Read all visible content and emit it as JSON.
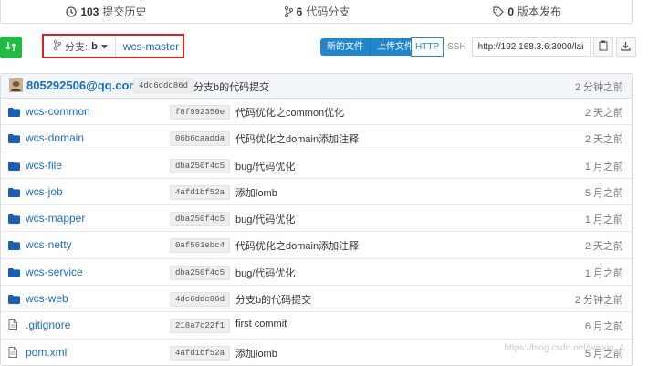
{
  "stats": {
    "commits": {
      "count": "103",
      "label": "提交历史"
    },
    "branches": {
      "count": "6",
      "label": "代码分支"
    },
    "releases": {
      "count": "0",
      "label": "版本发布"
    }
  },
  "toolbar": {
    "branch_prefix": "分支:",
    "branch_name": "b",
    "tree_path": "wcs-master",
    "new_file": "新的文件",
    "upload_file": "上传文件",
    "protocol_http": "HTTP",
    "protocol_ssh": "SSH",
    "clone_url": "http://192.168.3.6:3000/lai"
  },
  "latest_commit": {
    "author": "805292506@qq.com",
    "sha": "4dc6ddc86d",
    "message": "分支b的代码提交",
    "time": "2 分钟之前"
  },
  "files": [
    {
      "name": "wcs-common",
      "type": "folder",
      "sha": "f8f992350e",
      "message": "代码优化之common优化",
      "time": "2 天之前"
    },
    {
      "name": "wcs-domain",
      "type": "folder",
      "sha": "06b6caadda",
      "message": "代码优化之domain添加注释",
      "time": "2 天之前"
    },
    {
      "name": "wcs-file",
      "type": "folder",
      "sha": "dba250f4c5",
      "message": "bug/代码优化",
      "time": "1 月之前"
    },
    {
      "name": "wcs-job",
      "type": "folder",
      "sha": "4afd1bf52a",
      "message": "添加lomb",
      "time": "5 月之前"
    },
    {
      "name": "wcs-mapper",
      "type": "folder",
      "sha": "dba250f4c5",
      "message": "bug/代码优化",
      "time": "1 月之前"
    },
    {
      "name": "wcs-netty",
      "type": "folder",
      "sha": "0af561ebc4",
      "message": "代码优化之domain添加注释",
      "time": "2 天之前"
    },
    {
      "name": "wcs-service",
      "type": "folder",
      "sha": "dba250f4c5",
      "message": "bug/代码优化",
      "time": "1 月之前"
    },
    {
      "name": "wcs-web",
      "type": "folder",
      "sha": "4dc6ddc86d",
      "message": "分支b的代码提交",
      "time": "2 分钟之前"
    },
    {
      "name": ".gitignore",
      "type": "file",
      "sha": "218a7c22f1",
      "message": "first commit",
      "time": "6 月之前"
    },
    {
      "name": "pom.xml",
      "type": "file",
      "sha": "4afd1bf52a",
      "message": "添加lomb",
      "time": "5 月之前"
    }
  ],
  "watermark": "https://blog.csdn.net/weixin_4..."
}
